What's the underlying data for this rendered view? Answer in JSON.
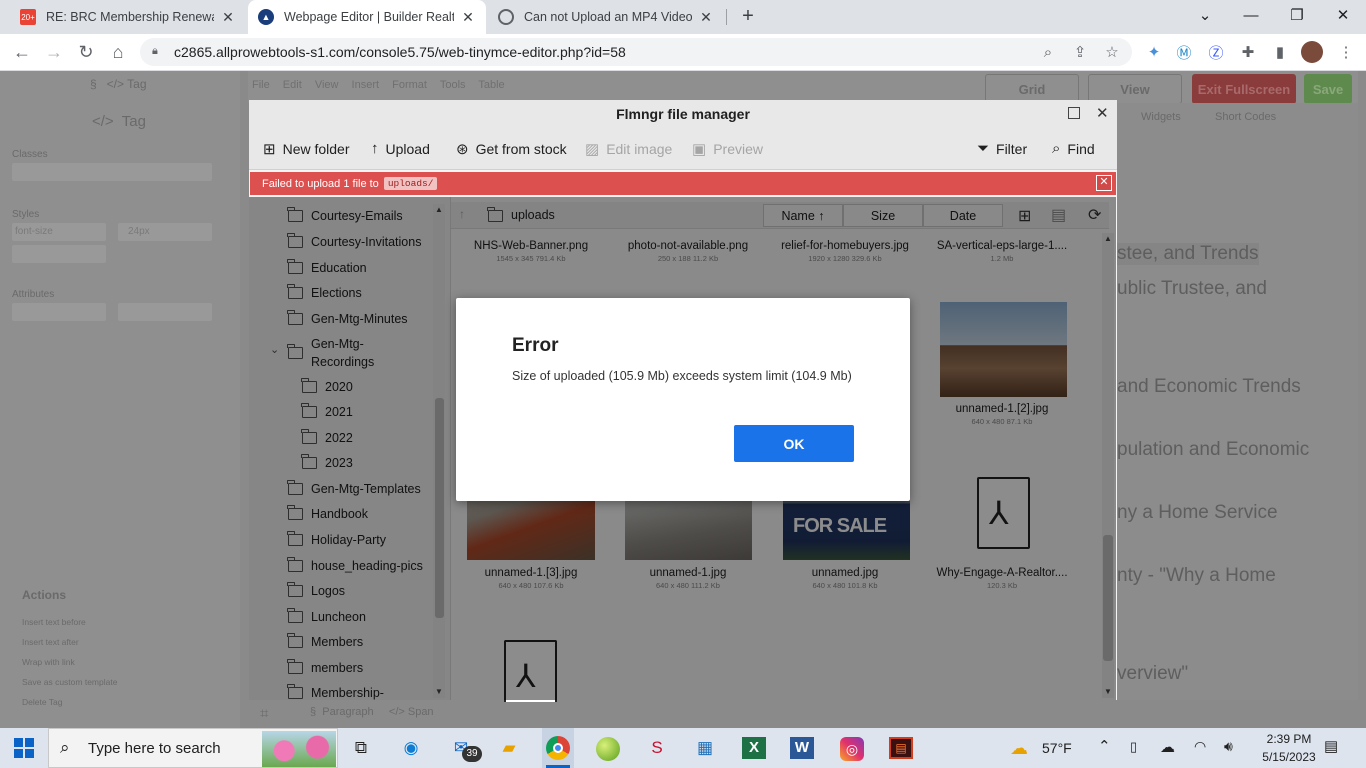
{
  "browser": {
    "tabs": [
      {
        "title": "RE: BRC Membership Renewal - n",
        "favicon_text": "20+"
      },
      {
        "title": "Webpage Editor | Builder Realty C",
        "favicon_text": ""
      },
      {
        "title": "Can not Upload an MP4 Video - ",
        "favicon_text": ""
      }
    ],
    "new_tab": "+",
    "url": "c2865.allprowebtools-s1.com/console5.75/web-tinymce-editor.php?id=58"
  },
  "editor": {
    "left_tag_small": "Tag",
    "left_tag": "Tag",
    "classes_label": "Classes",
    "styles_label": "Styles",
    "font_size_label": "font-size",
    "font_size_value": "24px",
    "attributes_label": "Attributes",
    "actions_label": "Actions",
    "actions": [
      "Insert text before",
      "Insert text after",
      "Wrap with link",
      "Save as custom template",
      "Delete Tag"
    ],
    "menu": [
      "File",
      "Edit",
      "View",
      "Insert",
      "Format",
      "Tools",
      "Table"
    ],
    "buttons": {
      "grid": "Grid",
      "view": "View",
      "exit_fullscreen": "Exit Fullscreen",
      "save": "Save"
    },
    "widgets": "Widgets",
    "short_codes": "Short Codes",
    "bg_lines": [
      "stee, and Trends",
      "ublic Trustee, and",
      "and Economic Trends",
      "pulation and Economic",
      "ny a Home Service",
      "nty - \"Why a Home",
      "verview\""
    ],
    "status": {
      "paragraph": "Paragraph",
      "span": "Span"
    }
  },
  "file_manager": {
    "title": "Flmngr file manager",
    "toolbar": {
      "new_folder": "New folder",
      "upload": "Upload",
      "get_from_stock": "Get from stock",
      "edit_image": "Edit image",
      "preview": "Preview",
      "filter": "Filter",
      "find": "Find"
    },
    "error_bar": {
      "text": "Failed to upload 1 file to",
      "folder": "uploads/"
    },
    "current_folder": "uploads",
    "columns": {
      "name": "Name",
      "size": "Size",
      "date": "Date"
    },
    "tree": [
      {
        "label": "Courtesy-Emails"
      },
      {
        "label": "Courtesy-Invitations"
      },
      {
        "label": "Education"
      },
      {
        "label": "Elections"
      },
      {
        "label": "Gen-Mtg-Minutes"
      },
      {
        "label": "Gen-Mtg-",
        "label2": "Recordings"
      },
      {
        "label": "2020"
      },
      {
        "label": "2021"
      },
      {
        "label": "2022"
      },
      {
        "label": "2023"
      },
      {
        "label": "Gen-Mtg-Templates"
      },
      {
        "label": "Handbook"
      },
      {
        "label": "Holiday-Party"
      },
      {
        "label": "house_heading-pics"
      },
      {
        "label": "Logos"
      },
      {
        "label": "Luncheon"
      },
      {
        "label": "Members"
      },
      {
        "label": "members"
      },
      {
        "label": "Membership-"
      }
    ],
    "files": [
      {
        "name": "NHS-Web-Banner.png",
        "meta": "1545 x 345     791.4 Kb"
      },
      {
        "name": "photo-not-available.png",
        "meta": "250 x 188     11.2 Kb"
      },
      {
        "name": "relief-for-homebuyers.jpg",
        "meta": "1920 x 1280     329.6 Kb"
      },
      {
        "name": "SA-vertical-eps-large-1....",
        "meta": "1.2 Mb"
      },
      {
        "name": "unnamed-1.[2].jpg",
        "meta": "640 x 480     87.1 Kb"
      },
      {
        "name": "unnamed-1.[3].jpg",
        "meta": "640 x 480     107.6 Kb"
      },
      {
        "name": "unnamed-1.jpg",
        "meta": "640 x 480     111.2 Kb"
      },
      {
        "name": "unnamed.jpg",
        "meta": "640 x 480     101.8 Kb"
      },
      {
        "name": "Why-Engage-A-Realtor....",
        "meta": "120.3 Kb"
      }
    ],
    "for_sale_text": "FOR SALE"
  },
  "dialog": {
    "title": "Error",
    "message": "Size of uploaded (105.9 Mb) exceeds system limit (104.9 Mb)",
    "ok": "OK"
  },
  "taskbar": {
    "search_placeholder": "Type here to search",
    "mail_badge": "39",
    "weather": "57°F",
    "time": "2:39 PM",
    "date": "5/15/2023"
  }
}
